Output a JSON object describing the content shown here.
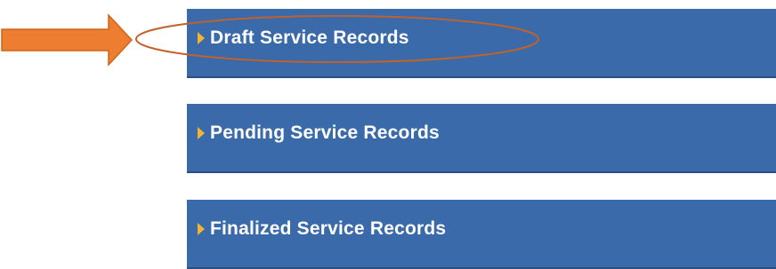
{
  "panels": [
    {
      "label": "Draft Service Records"
    },
    {
      "label": "Pending Service Records"
    },
    {
      "label": "Finalized Service Records"
    }
  ],
  "colors": {
    "panel_bg": "#3a6aa9",
    "panel_border": "#2a4f83",
    "expand_arrow": "#f2b431",
    "annotation_arrow": "#ed7d31",
    "annotation_ellipse": "#c0622a"
  },
  "icons": {
    "expand": "triangle-right-icon",
    "annotation_pointer": "arrow-right-icon",
    "annotation_highlight": "ellipse-highlight"
  }
}
